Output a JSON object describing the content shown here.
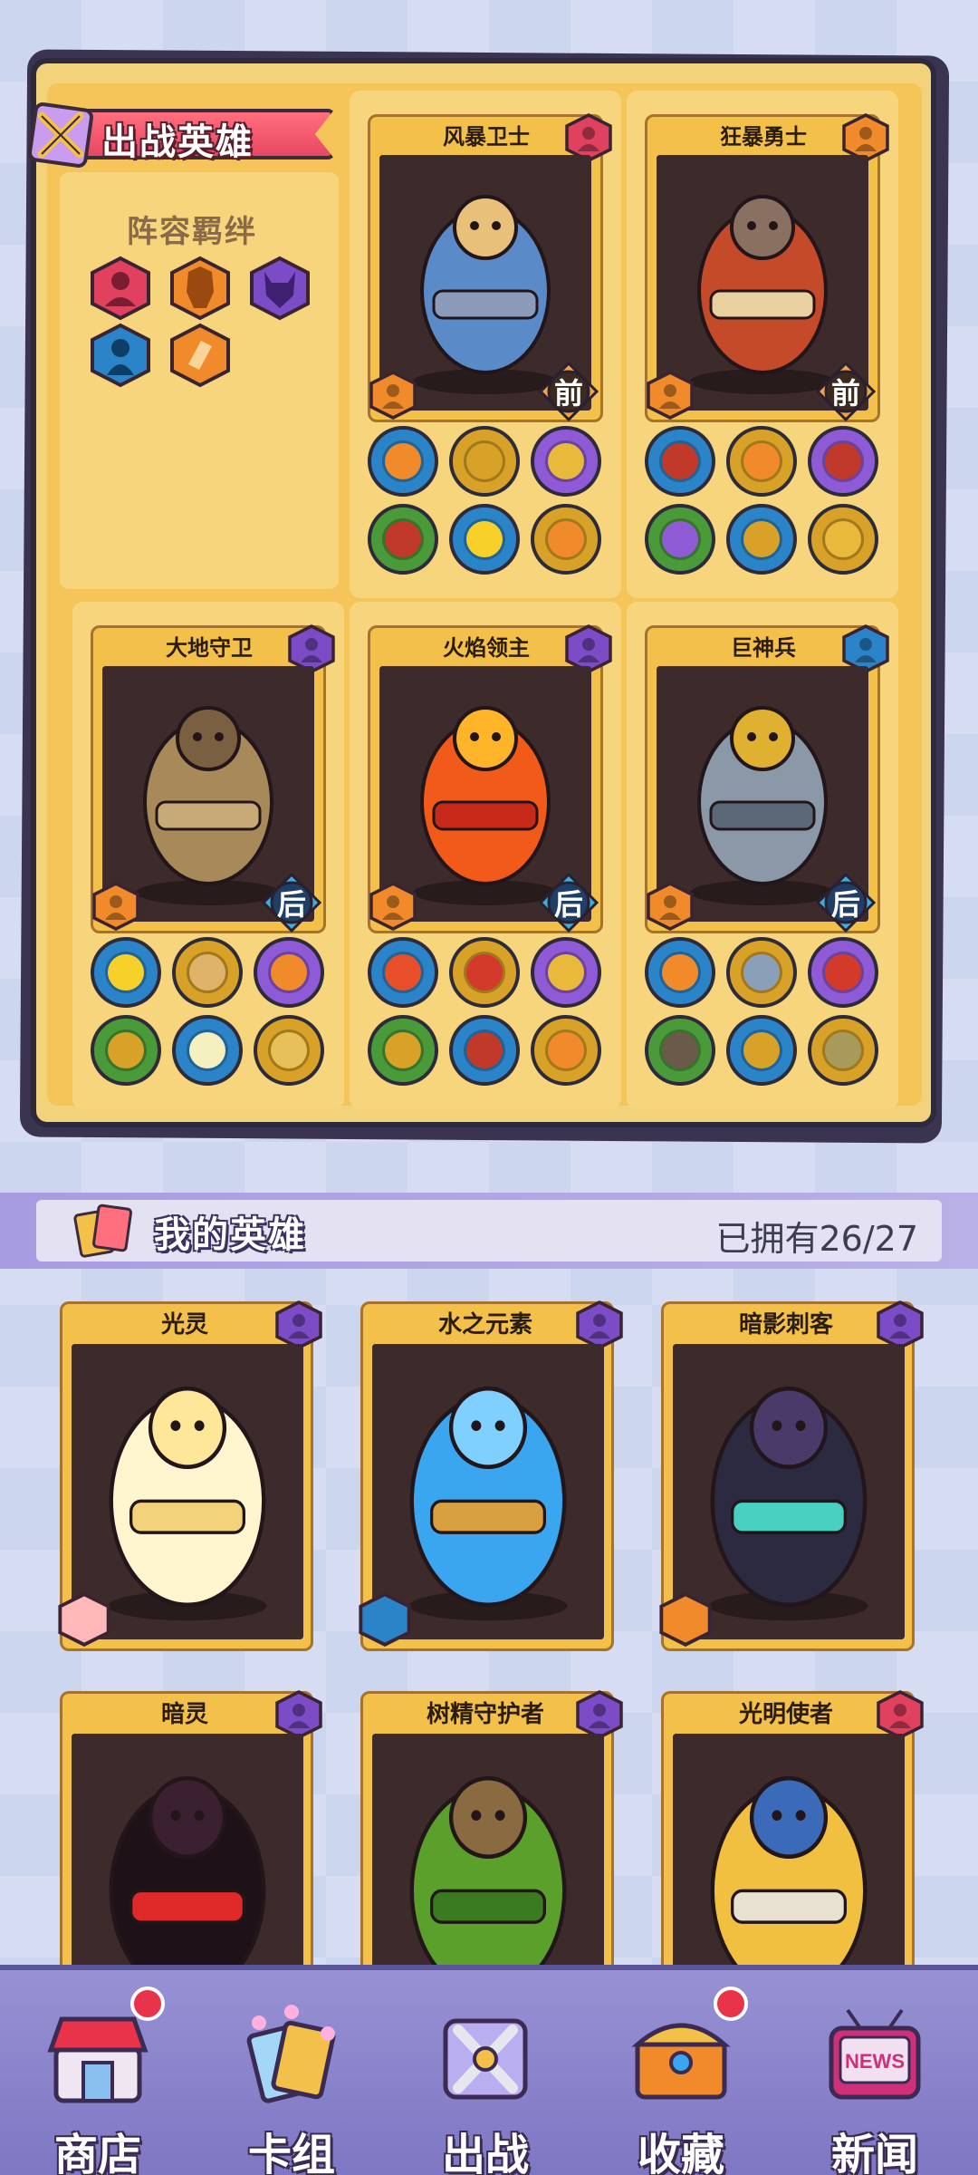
{
  "lineup": {
    "title": "出战英雄",
    "bond_title": "阵容羁绊",
    "bonds": [
      {
        "icon": "warrior-icon",
        "color": "#e0415f"
      },
      {
        "icon": "berserker-icon",
        "color": "#f08a2a"
      },
      {
        "icon": "demon-icon",
        "color": "#7c4cc6"
      },
      {
        "icon": "mage-icon",
        "color": "#2b84c8"
      },
      {
        "icon": "shard-icon",
        "color": "#f08a2a"
      }
    ],
    "slots": [
      {
        "name": "风暴卫士",
        "position": "前",
        "faction_color": "#e0415f",
        "equip": [
          "#f08a2a",
          "#d8a127",
          "#e8b93a",
          "#c0392b",
          "#f7d02a",
          "#f08a2a"
        ]
      },
      {
        "name": "狂暴勇士",
        "position": "前",
        "faction_color": "#f08a2a",
        "equip": [
          "#c0392b",
          "#f08a2a",
          "#c0392b",
          "#8e5ad6",
          "#d8a127",
          "#e8b93a"
        ]
      },
      {
        "name": "大地守卫",
        "position": "后",
        "faction_color": "#7c4cc6",
        "equip": [
          "#f7d02a",
          "#e0b36a",
          "#f08a2a",
          "#d8a127",
          "#f5f0c0",
          "#e8c05a"
        ]
      },
      {
        "name": "火焰领主",
        "position": "后",
        "faction_color": "#7c4cc6",
        "equip": [
          "#e84e2a",
          "#d33a2a",
          "#e8b93a",
          "#d8a127",
          "#c0392b",
          "#f08a2a"
        ]
      },
      {
        "name": "巨神兵",
        "position": "后",
        "faction_color": "#2b84c8",
        "equip": [
          "#f08a2a",
          "#8aa0b8",
          "#d33a2a",
          "#6b5a4a",
          "#d8a127",
          "#a89a5a"
        ]
      }
    ]
  },
  "my_heroes": {
    "title": "我的英雄",
    "owned": "已拥有26/27",
    "cards": [
      {
        "name": "光灵",
        "faction_color": "#7c4cc6",
        "class_icon": "healer-icon"
      },
      {
        "name": "水之元素",
        "faction_color": "#7c4cc6",
        "class_icon": "shield-icon"
      },
      {
        "name": "暗影刺客",
        "faction_color": "#7c4cc6",
        "class_icon": "crossed-swords-icon"
      },
      {
        "name": "暗灵",
        "faction_color": "#7c4cc6",
        "class_icon": "mage-icon"
      },
      {
        "name": "树精守护者",
        "faction_color": "#7c4cc6",
        "class_icon": "healer-icon"
      },
      {
        "name": "光明使者",
        "faction_color": "#e0415f",
        "class_icon": "knight-icon"
      }
    ]
  },
  "nav": [
    {
      "label": "商店",
      "icon": "shop-icon",
      "badge": true
    },
    {
      "label": "卡组",
      "icon": "deck-icon",
      "badge": false
    },
    {
      "label": "出战",
      "icon": "battle-icon",
      "badge": false
    },
    {
      "label": "收藏",
      "icon": "chest-icon",
      "badge": true
    },
    {
      "label": "新闻",
      "icon": "news-tv-icon",
      "badge": false,
      "icon_text": "NEWS"
    }
  ]
}
